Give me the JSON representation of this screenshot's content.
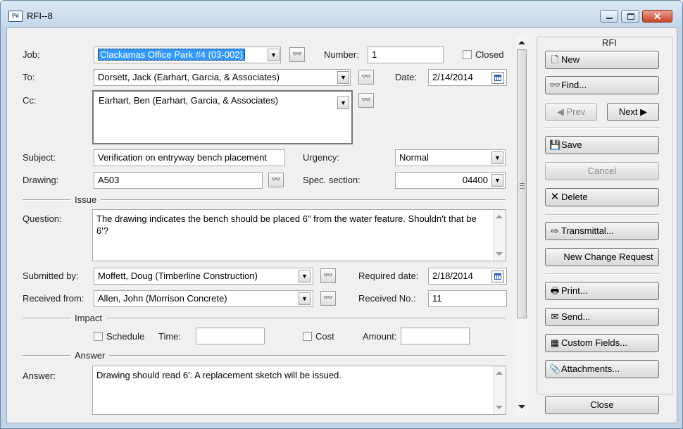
{
  "window": {
    "title": "RFI--8",
    "app_icon_text": "P#"
  },
  "form": {
    "job": {
      "label": "Job:",
      "value": "Clackamas Office Park #4 (03-002)"
    },
    "number": {
      "label": "Number:",
      "value": "1"
    },
    "closed": {
      "label": "Closed",
      "checked": false
    },
    "to": {
      "label": "To:",
      "value": "Dorsett, Jack (Earhart, Garcia, & Associates)"
    },
    "date": {
      "label": "Date:",
      "value": "2/14/2014"
    },
    "cc": {
      "label": "Cc:",
      "value": "Earhart, Ben (Earhart, Garcia, & Associates)"
    },
    "subject": {
      "label": "Subject:",
      "value": "Verification on entryway bench placement"
    },
    "urgency": {
      "label": "Urgency:",
      "value": "Normal"
    },
    "drawing": {
      "label": "Drawing:",
      "value": "A503"
    },
    "spec_section": {
      "label": "Spec. section:",
      "value": "04400"
    },
    "issue_section": "Issue",
    "question": {
      "label": "Question:",
      "value": "The drawing indicates the bench should be placed 6\" from the water feature. Shouldn't that be 6'?"
    },
    "submitted_by": {
      "label": "Submitted by:",
      "value": "Moffett, Doug (Timberline Construction)"
    },
    "required_date": {
      "label": "Required date:",
      "value": "2/18/2014"
    },
    "received_from": {
      "label": "Received from:",
      "value": "Allen, John (Morrison Concrete)"
    },
    "received_no": {
      "label": "Received No.:",
      "value": "11"
    },
    "impact_section": "Impact",
    "schedule": {
      "label": "Schedule",
      "checked": false
    },
    "time": {
      "label": "Time:",
      "value": ""
    },
    "cost": {
      "label": "Cost",
      "checked": false
    },
    "amount": {
      "label": "Amount:",
      "value": ""
    },
    "answer_section": "Answer",
    "answer": {
      "label": "Answer:",
      "value": "Drawing should read 6'. A replacement sketch will be issued."
    }
  },
  "panel": {
    "title": "RFI",
    "new": "New",
    "find": "Find...",
    "prev": "Prev",
    "next": "Next",
    "save": "Save",
    "cancel": "Cancel",
    "delete": "Delete",
    "transmittal": "Transmittal...",
    "new_change_request": "New Change Request",
    "print": "Print...",
    "send": "Send...",
    "custom_fields": "Custom Fields...",
    "attachments": "Attachments...",
    "close": "Close"
  },
  "icons": {
    "binoculars": "binoculars-icon",
    "dropdown": "chevron-down-icon",
    "calendar": "calendar-icon"
  },
  "colors": {
    "selection": "#3399ff",
    "titlebar": "#c5d6ea",
    "close_button": "#c7452a"
  }
}
